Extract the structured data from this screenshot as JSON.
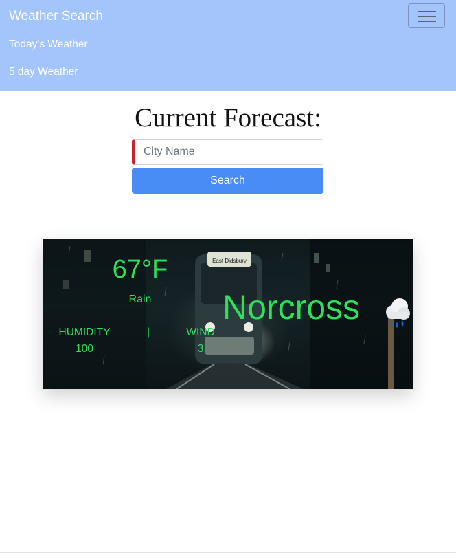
{
  "navbar": {
    "brand": "Weather Search",
    "links": [
      "Today's Weather",
      "5 day Weather"
    ],
    "background_color": "#a4c4fc",
    "toggler_icon": "hamburger-menu-icon"
  },
  "main": {
    "title": "Current Forecast:",
    "search": {
      "placeholder": "City Name",
      "value": "",
      "button_label": "Search",
      "button_color": "#4a8cf5",
      "input_accent_color": "#c9202f"
    }
  },
  "weather_card": {
    "temperature": "67°F",
    "condition": "Rain",
    "city": "Norcross",
    "humidity_label": "HUMIDITY",
    "humidity_value": "100",
    "separator": "|",
    "wind_label": "WIND",
    "wind_value": "3",
    "text_color": "#2fe05a",
    "icon": "rain-cloud-icon",
    "background_sign": "East Didsbury"
  }
}
